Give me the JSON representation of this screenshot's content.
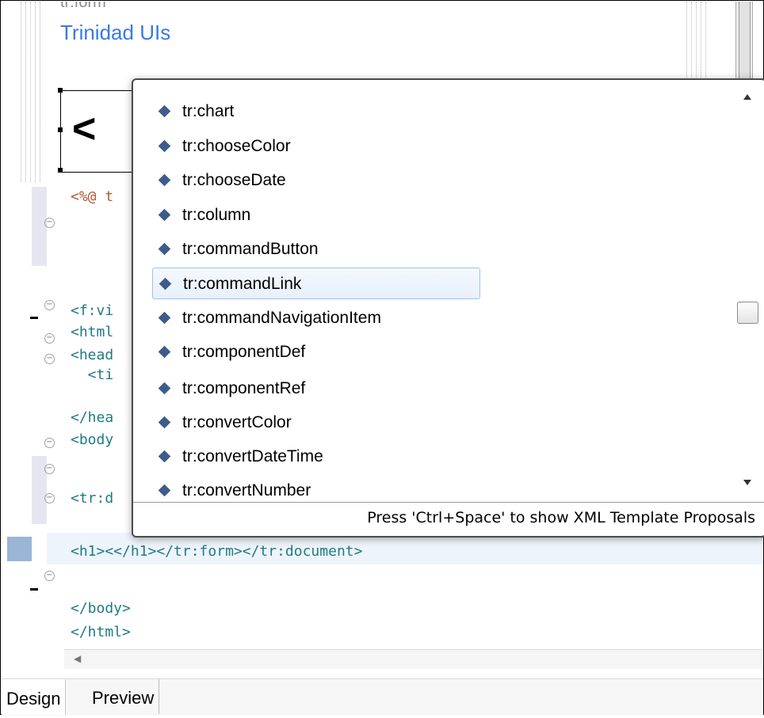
{
  "design": {
    "clipped_text": "tr:form",
    "title": "Trinidad UIs",
    "selected_char": "<"
  },
  "editor": {
    "lines": [
      {
        "text": "<%@ t",
        "color": "#b45a32"
      },
      {
        "text": "<f:vi",
        "color": "#1f7b83"
      },
      {
        "text": "<html",
        "color": "#1f7b83"
      },
      {
        "text": "<head",
        "color": "#1f7b83"
      },
      {
        "text": "  <ti",
        "color": "#1f7b83"
      },
      {
        "text": "</hea",
        "color": "#1f7b83"
      },
      {
        "text": "<body",
        "color": "#1f7b83"
      },
      {
        "text": "<tr:d",
        "color": "#1f7b83"
      },
      {
        "text": "<h1><</h1></tr:form></tr:document>",
        "color": "#1f7b83"
      },
      {
        "text": "</body>",
        "color": "#1f7b83"
      },
      {
        "text": "</html>",
        "color": "#1f7b83"
      }
    ]
  },
  "proposals": {
    "items": [
      {
        "label": "tr:chart"
      },
      {
        "label": "tr:chooseColor"
      },
      {
        "label": "tr:chooseDate"
      },
      {
        "label": "tr:column"
      },
      {
        "label": "tr:commandButton"
      },
      {
        "label": "tr:commandLink",
        "selected": true
      },
      {
        "label": "tr:commandNavigationItem"
      },
      {
        "label": "tr:componentDef"
      },
      {
        "label": "tr:componentRef"
      },
      {
        "label": "tr:convertColor"
      },
      {
        "label": "tr:convertDateTime"
      },
      {
        "label": "tr:convertNumber"
      }
    ],
    "status": "Press 'Ctrl+Space' to show XML Template Proposals"
  },
  "tabs": [
    {
      "label": "Design",
      "active": true
    },
    {
      "label": "Preview",
      "active": false
    }
  ],
  "colors": {
    "title_blue": "#3b78e7",
    "tag_teal": "#1f7b83",
    "directive_brown": "#b45a32",
    "selection_border": "#9cc3ec",
    "diamond_icon": "#3e5c8a"
  }
}
